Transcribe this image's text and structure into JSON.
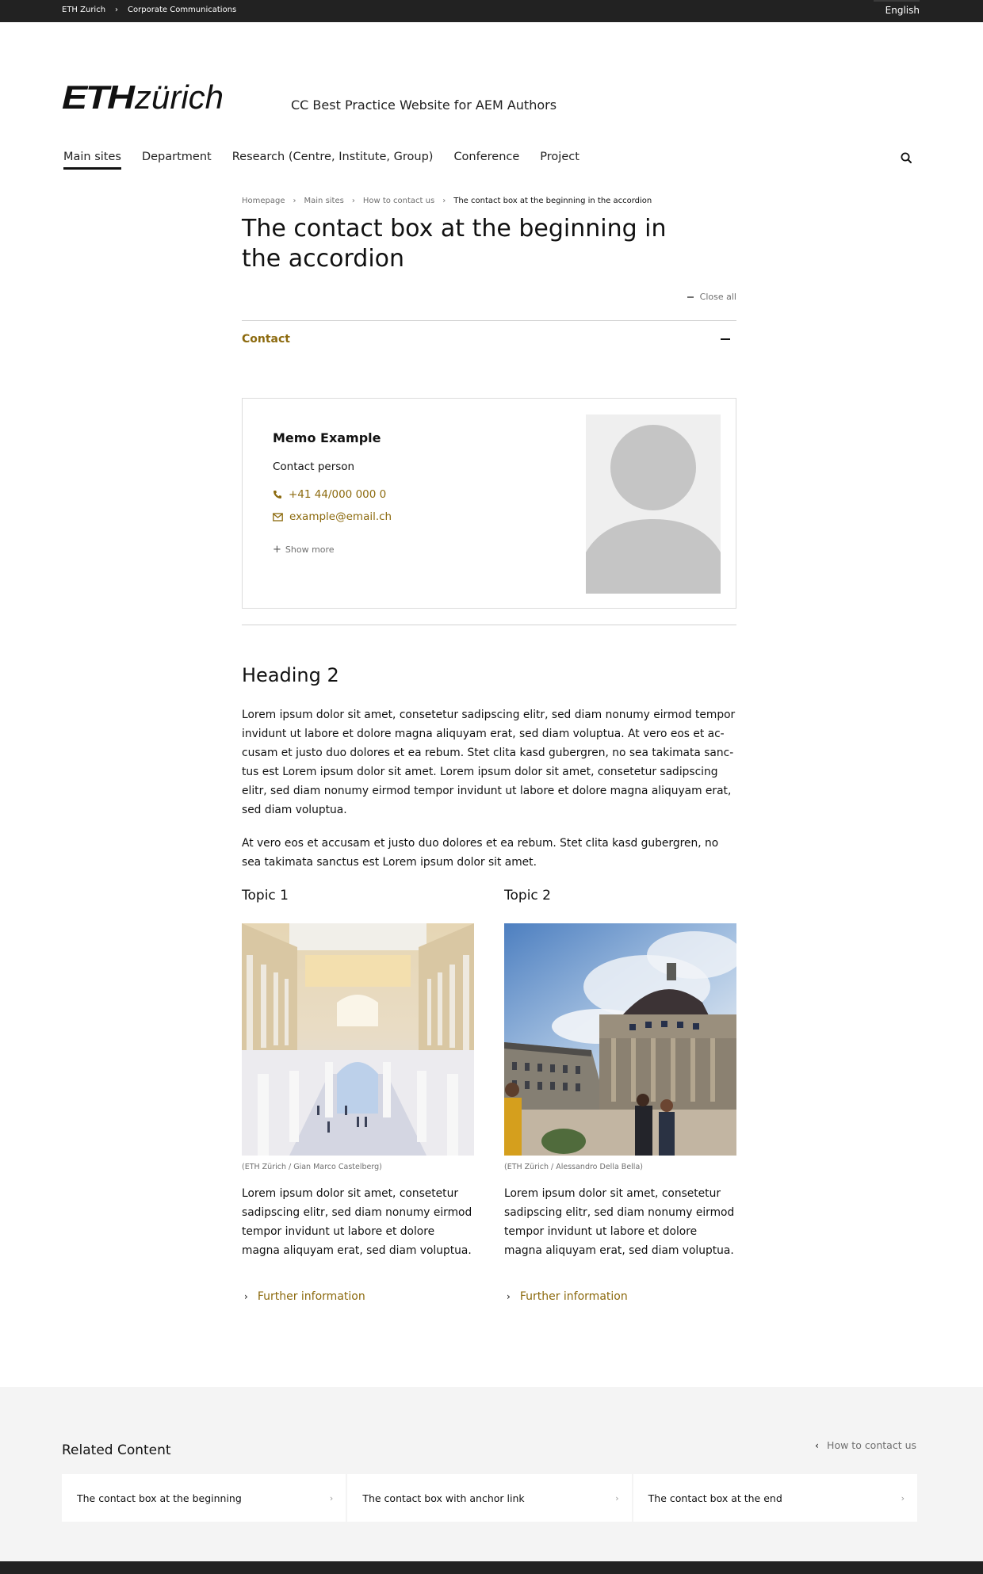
{
  "topbar": {
    "breadcrumb": [
      "ETH Zurich",
      "Corporate Communications"
    ],
    "language": "English"
  },
  "header": {
    "logo_bold": "ETH",
    "logo_light": "zürich",
    "site_title": "CC Best Practice Website for AEM Authors",
    "nav": [
      {
        "label": "Main sites",
        "active": true
      },
      {
        "label": "Department"
      },
      {
        "label": "Research (Centre, Institute, Group)"
      },
      {
        "label": "Conference"
      },
      {
        "label": "Project"
      }
    ],
    "search_icon": "search-icon"
  },
  "breadcrumb": [
    "Homepage",
    "Main sites",
    "How to contact us",
    "The contact box at the beginning in the accordion"
  ],
  "page_title": "The contact box at the beginning in the accordion",
  "accordion": {
    "close_all": "Close all",
    "section_label": "Contact",
    "accent_color": "#8c6a0e"
  },
  "contact": {
    "name": "Memo Example",
    "role": "Contact person",
    "phone": "+41 44/000 000 0",
    "email": "example@email.ch",
    "show_more": "Show more"
  },
  "article": {
    "heading": "Heading 2",
    "paragraph1": "Lorem ipsum dolor sit amet, consetetur sadipscing elitr, sed diam nonumy eirmod tempor invidunt ut labore et dolore magna aliquyam erat, sed diam voluptua. At vero eos et ac­cusam et justo duo dolores et ea rebum. Stet clita kasd gubergren, no sea takimata sanc­tus est Lorem ipsum dolor sit amet. Lorem ipsum dolor sit amet, consetetur sadipscing elitr, sed diam nonumy eirmod tempor invidunt ut labore et dolore magna aliquyam erat, sed diam voluptua.",
    "paragraph2": "At vero eos et accusam et justo duo dolores et ea rebum. Stet clita kasd gubergren, no sea takimata sanctus est Lorem ipsum dolor sit amet."
  },
  "topics": [
    {
      "title": "Topic 1",
      "image_alt": "ETH Zurich main building atrium with arcades",
      "caption": "(ETH Zürich / Gian Marco Castelberg)",
      "text": "Lorem ipsum dolor sit amet, consetetur sadipscing elitr, sed diam nonumy eirmod tempor invidunt ut labore et dolore magna aliquyam erat, sed diam voluptua.",
      "link": "Further information"
    },
    {
      "title": "Topic 2",
      "image_alt": "ETH Zurich main building dome exterior with students",
      "caption": "(ETH Zürich / Alessandro Della Bella)",
      "text": "Lorem ipsum dolor sit amet, consetetur sadipscing elitr, sed diam nonumy eirmod tempor invidunt ut labore et dolore magna aliquyam erat, sed diam voluptua.",
      "link": "Further information"
    }
  ],
  "related": {
    "heading": "Related Content",
    "back_link": "How to contact us",
    "items": [
      "The contact box at the beginning",
      "The contact box with anchor link",
      "The contact box at the end"
    ]
  }
}
